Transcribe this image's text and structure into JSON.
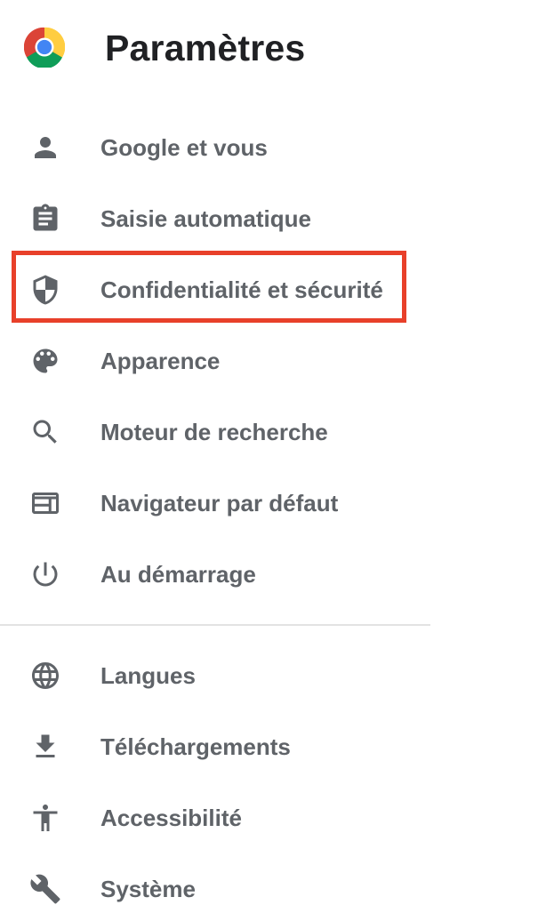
{
  "header": {
    "title": "Paramètres",
    "logo": "chrome-logo"
  },
  "nav": {
    "items": [
      {
        "label": "Google et vous",
        "icon": "person-icon"
      },
      {
        "label": "Saisie automatique",
        "icon": "clipboard-icon"
      },
      {
        "label": "Confidentialité et sécurité",
        "icon": "shield-icon",
        "highlighted": true
      },
      {
        "label": "Apparence",
        "icon": "palette-icon"
      },
      {
        "label": "Moteur de recherche",
        "icon": "search-icon"
      },
      {
        "label": "Navigateur par défaut",
        "icon": "browser-window-icon"
      },
      {
        "label": "Au démarrage",
        "icon": "power-icon"
      }
    ],
    "advanced_items": [
      {
        "label": "Langues",
        "icon": "globe-icon"
      },
      {
        "label": "Téléchargements",
        "icon": "download-icon"
      },
      {
        "label": "Accessibilité",
        "icon": "accessibility-icon"
      },
      {
        "label": "Système",
        "icon": "wrench-icon"
      }
    ]
  },
  "colors": {
    "highlight": "#e8402a",
    "text": "#5f6368",
    "title": "#202124",
    "divider": "#e3e3e3"
  }
}
